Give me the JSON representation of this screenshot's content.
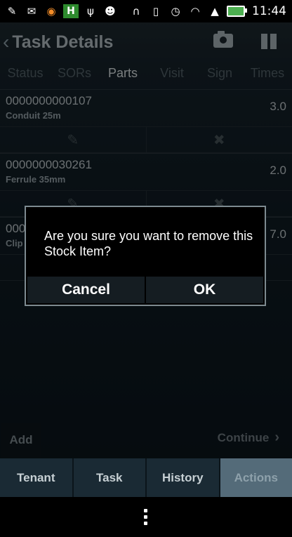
{
  "status_bar": {
    "time": "11:44",
    "left_icons": [
      "edit-icon",
      "mail-icon",
      "orange-circle-icon",
      "h-app-icon",
      "usb-icon",
      "android-icon"
    ],
    "right_icons": [
      "headset-icon",
      "vibrate-icon",
      "alarm-icon",
      "wifi-icon",
      "signal-icon",
      "battery-icon"
    ]
  },
  "header": {
    "title": "Task Details"
  },
  "tabs": [
    "Status",
    "SORs",
    "Parts",
    "Visit",
    "Sign",
    "Times"
  ],
  "active_tab": "Parts",
  "items": [
    {
      "code": "0000000000107",
      "desc": "Conduit 25m",
      "qty": "3.0"
    },
    {
      "code": "0000000030261",
      "desc": "Ferrule 35mm",
      "qty": "2.0"
    },
    {
      "code": "000",
      "desc": "Clip",
      "qty": "7.0"
    }
  ],
  "dialog": {
    "message": "Are you sure you want to remove this Stock Item?",
    "cancel_label": "Cancel",
    "ok_label": "OK"
  },
  "footer": {
    "add_label": "Add",
    "continue_label": "Continue"
  },
  "bottom_tabs": [
    "Tenant",
    "Task",
    "History",
    "Actions"
  ],
  "colors": {
    "background": "#101c24",
    "bottom_tab_active": "#546b79",
    "dialog_border": "#7d8a90"
  }
}
